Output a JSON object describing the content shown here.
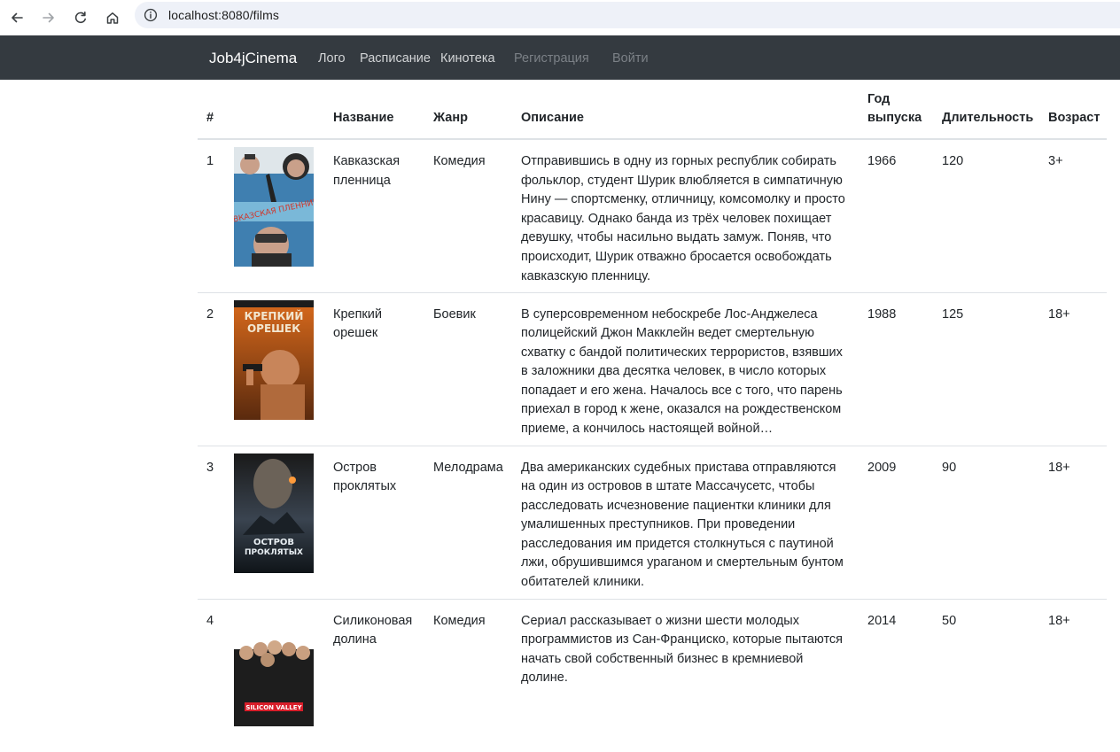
{
  "browser": {
    "url": "localhost:8080/films"
  },
  "navbar": {
    "brand": "Job4jCinema",
    "links": [
      {
        "label": "Лого"
      },
      {
        "label": "Расписание"
      },
      {
        "label": "Кинотека"
      },
      {
        "label": "Регистрация"
      },
      {
        "label": "Войти"
      }
    ]
  },
  "table": {
    "headers": {
      "num": "#",
      "poster": "",
      "name": "Название",
      "genre": "Жанр",
      "description": "Описание",
      "year": "Год выпуска",
      "duration": "Длительность",
      "age": "Возраст"
    },
    "rows": [
      {
        "num": "1",
        "name": "Кавказская пленница",
        "genre": "Комедия",
        "description": "Отправившись в одну из горных республик собирать фольклор, студент Шурик влюбляется в симпатичную Нину — спортсменку, отличницу, комсомолку и просто красавицу. Однако банда из трёх человек похищает девушку, чтобы насильно выдать замуж. Поняв, что происходит, Шурик отважно бросается освобождать кавказскую пленницу.",
        "year": "1966",
        "duration": "120",
        "age": "3+",
        "poster_text": "КАВКАЗСКАЯ ПЛЕННИЦА"
      },
      {
        "num": "2",
        "name": "Крепкий орешек",
        "genre": "Боевик",
        "description": "В суперсовременном небоскребе Лос-Анджелеса полицейский Джон Макклейн ведет смертельную схватку с бандой политических террористов, взявших в заложники два десятка человек, в число которых попадает и его жена. Началось все с того, что парень приехал в город к жене, оказался на рождественском приеме, а кончилось настоящей войной…",
        "year": "1988",
        "duration": "125",
        "age": "18+",
        "poster_text": "КРЕПКИЙ ОРЕШЕК"
      },
      {
        "num": "3",
        "name": "Остров проклятых",
        "genre": "Мелодрама",
        "description": "Два американских судебных пристава отправляются на один из островов в штате Массачусетс, чтобы расследовать исчезновение пациентки клиники для умалишенных преступников. При проведении расследования им придется столкнуться с паутиной лжи, обрушившимся ураганом и смертельным бунтом обитателей клиники.",
        "year": "2009",
        "duration": "90",
        "age": "18+",
        "poster_text": "ОСТРОВ ПРОКЛЯТЫХ"
      },
      {
        "num": "4",
        "name": "Силиконовая долина",
        "genre": "Комедия",
        "description": "Сериал рассказывает о жизни шести молодых программистов из Сан-Франциско, которые пытаются начать свой собственный бизнес в кремниевой долине.",
        "year": "2014",
        "duration": "50",
        "age": "18+",
        "poster_text": "SILICON VALLEY"
      }
    ]
  }
}
